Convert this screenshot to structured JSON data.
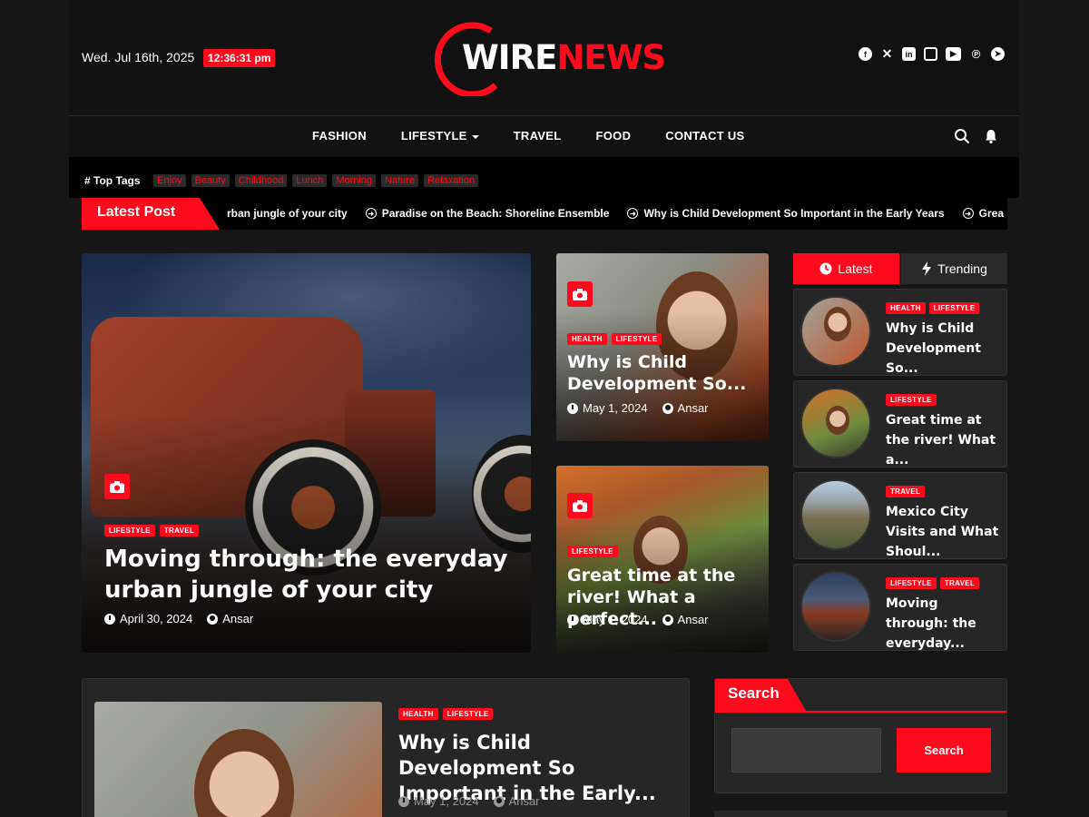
{
  "header": {
    "date": "Wed. Jul 16th, 2025",
    "time": "12:36:31 pm",
    "logo_part1": "WIRE",
    "logo_part2": "NEWS",
    "socials": [
      "facebook-icon",
      "x-icon",
      "linkedin-icon",
      "instagram-icon",
      "youtube-icon",
      "pinterest-icon",
      "telegram-icon"
    ]
  },
  "nav": {
    "items": [
      "FASHION",
      "LIFESTYLE",
      "TRAVEL",
      "FOOD",
      "CONTACT US"
    ]
  },
  "top_tags": {
    "title": "# Top Tags",
    "tags": [
      "Enjoy",
      "Beauty",
      "Childhood",
      "Lunch",
      "Morning",
      "Nature",
      "Relaxation"
    ]
  },
  "ticker": {
    "label": "Latest Post",
    "items": [
      "rban jungle of your city",
      "Paradise on the Beach: Shoreline Ensemble",
      "Why is Child Development So Important in the Early Years",
      "Grea"
    ]
  },
  "hero": {
    "badges": [
      "LIFESTYLE",
      "TRAVEL"
    ],
    "title_line1": "Moving through: the everyday",
    "title_line2": "urban jungle of your city",
    "date": "April 30, 2024",
    "author": "Ansar"
  },
  "cards": [
    {
      "badges": [
        "HEALTH",
        "LIFESTYLE"
      ],
      "title_line1": "Why is Child",
      "title_line2": "Development So...",
      "date": "May 1, 2024",
      "author": "Ansar"
    },
    {
      "badges": [
        "LIFESTYLE"
      ],
      "title_line1": "Great time at the",
      "title_line2": "river! What a perfect...",
      "date": "May 1, 2024",
      "author": "Ansar"
    }
  ],
  "sidebar": {
    "tab_latest": "Latest",
    "tab_trending": "Trending",
    "items": [
      {
        "badges": [
          "HEALTH",
          "LIFESTYLE"
        ],
        "title": "Why is Child Development So..."
      },
      {
        "badges": [
          "LIFESTYLE"
        ],
        "title": "Great time at the river! What a..."
      },
      {
        "badges": [
          "TRAVEL"
        ],
        "title": "Mexico City Visits and What Shoul..."
      },
      {
        "badges": [
          "LIFESTYLE",
          "TRAVEL"
        ],
        "title": "Moving through: the everyday..."
      }
    ]
  },
  "feature": {
    "badges": [
      "HEALTH",
      "LIFESTYLE"
    ],
    "title": "Why is Child Development So Important in the Early...",
    "date": "May 1, 2024",
    "author": "Ansar"
  },
  "search_widget": {
    "title": "Search",
    "placeholder": "",
    "button": "Search"
  },
  "colors": {
    "accent": "#ff0a1c",
    "bg": "#161616",
    "panel": "#262626"
  }
}
